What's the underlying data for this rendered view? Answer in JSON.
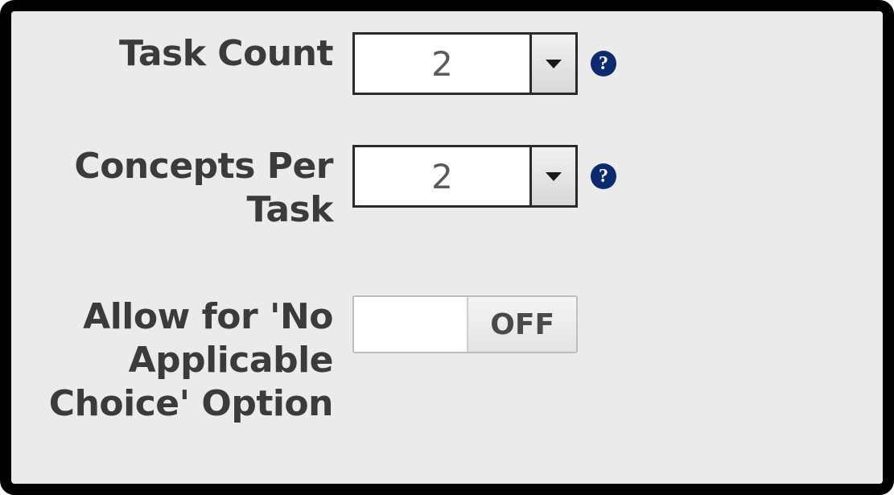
{
  "fields": {
    "task_count": {
      "label": "Task Count",
      "value": "2",
      "help_tooltip": "?"
    },
    "concepts_per_task": {
      "label": "Concepts Per Task",
      "value": "2",
      "help_tooltip": "?"
    },
    "no_applicable_choice": {
      "label": "Allow for 'No Applicable Choice' Option",
      "state_text": "OFF",
      "state": false
    }
  }
}
